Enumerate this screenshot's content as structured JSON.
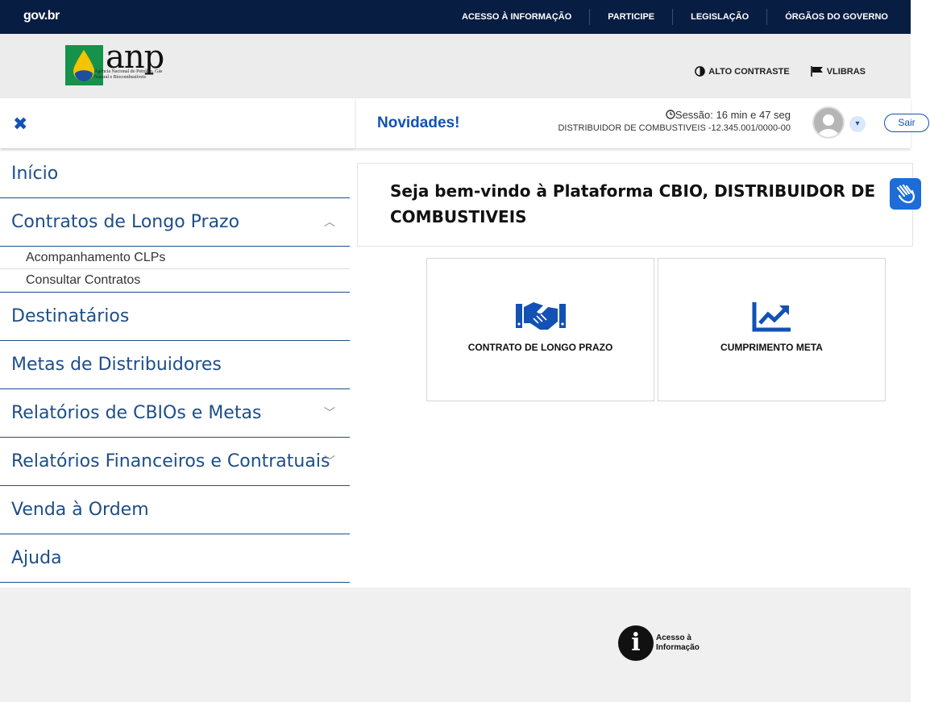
{
  "govbar": {
    "logo": "gov.br",
    "links": [
      "ACESSO À INFORMAÇÃO",
      "PARTICIPE",
      "LEGISLAÇÃO",
      "ÓRGÃOS DO GOVERNO"
    ]
  },
  "header": {
    "logo_text": "anp",
    "logo_sub": "Agência Nacional do Petróleo, Gás Natural e Biocombustíveis",
    "contrast_label": "ALTO CONTRASTE",
    "vlibras_label": "VLIBRAS"
  },
  "topbar": {
    "novidades": "Novidades!",
    "session": "Sessão: 16 min e 47 seg",
    "distributor": "DISTRIBUIDOR DE COMBUSTIVEIS -12.345.001/0000-00",
    "logout": "Sair"
  },
  "sidebar": {
    "items": [
      {
        "label": "Início"
      },
      {
        "label": "Contratos de Longo Prazo"
      },
      {
        "label": "Destinatários"
      },
      {
        "label": "Metas de Distribuidores"
      },
      {
        "label": "Relatórios de CBIOs e Metas"
      },
      {
        "label": "Relatórios Financeiros e Contratuais"
      },
      {
        "label": "Venda à Ordem"
      },
      {
        "label": "Ajuda"
      }
    ],
    "subitems": [
      "Acompanhamento CLPs",
      "Consultar Contratos"
    ]
  },
  "main": {
    "welcome": "Seja bem-vindo à Plataforma CBIO, DISTRIBUIDOR DE COMBUSTIVEIS",
    "cards": [
      {
        "label": "CONTRATO DE LONGO PRAZO",
        "icon": "handshake-icon"
      },
      {
        "label": "CUMPRIMENTO META",
        "icon": "chart-line-icon"
      }
    ]
  },
  "footer": {
    "acesso_label": "Acesso à Informação"
  },
  "colors": {
    "govbar_bg": "#071d41",
    "accent": "#1351b4",
    "menu_text": "#1d4e89"
  }
}
